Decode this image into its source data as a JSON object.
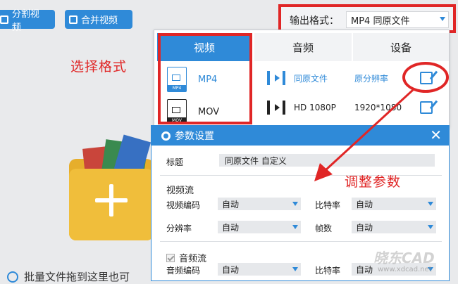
{
  "toolbar": {
    "split_label": "分割视频",
    "merge_label": "合并视频",
    "output_format_label": "输出格式：",
    "output_format_value": "MP4  同原文件"
  },
  "annotations": {
    "select_format": "选择格式",
    "adjust_params": "调整参数"
  },
  "drop_area": {
    "tip": "批量文件拖到这里也可"
  },
  "format_panel": {
    "tabs": [
      "视频",
      "音频",
      "设备"
    ],
    "formats": [
      "MP4",
      "MOV"
    ],
    "format_badges": [
      "MP4",
      "MOV"
    ],
    "presets": [
      {
        "name": "同原文件",
        "resolution": "原分辨率"
      },
      {
        "name": "HD 1080P",
        "resolution": "1920*1080"
      }
    ]
  },
  "dialog": {
    "title": "参数设置",
    "close": "✕",
    "title_label": "标题",
    "title_value": "同原文件 自定义",
    "video_stream": "视频流",
    "video_codec_label": "视频编码",
    "video_codec_value": "自动",
    "bitrate_label": "比特率",
    "bitrate_value": "自动",
    "resolution_label": "分辨率",
    "resolution_value": "自动",
    "fps_label": "帧数",
    "fps_value": "自动",
    "audio_stream": "音频流",
    "audio_codec_label": "音频编码",
    "audio_codec_value": "自动",
    "audio_bitrate_label": "比特率",
    "audio_bitrate_value": "自动"
  },
  "watermark": {
    "brand": "晓东CAD",
    "url": "www.xdcad.net"
  },
  "colors": {
    "accent": "#2f8ad8",
    "annotation": "#e02626",
    "folder": "#f0be3b"
  }
}
